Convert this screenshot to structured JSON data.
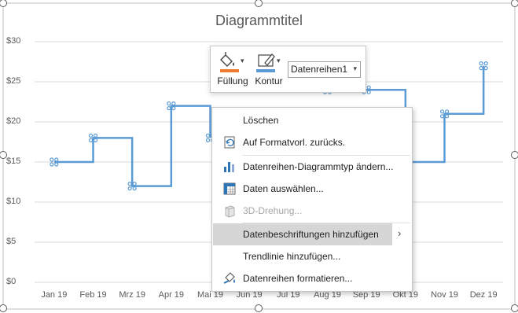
{
  "chart_data": {
    "type": "line",
    "title": "Diagrammtitel",
    "categories": [
      "Jan 19",
      "Feb 19",
      "Mrz 19",
      "Apr 19",
      "Mai 19",
      "Jun 19",
      "Jul 19",
      "Aug 19",
      "Sep 19",
      "Okt 19",
      "Nov 19",
      "Dez 19"
    ],
    "series": [
      {
        "values": [
          15,
          18,
          12,
          22,
          18,
          null,
          null,
          24,
          24,
          15,
          21,
          27
        ],
        "color": "#5b9bd5",
        "style": "step"
      }
    ],
    "yticks": [
      "$0",
      "$5",
      "$10",
      "$15",
      "$20",
      "$25",
      "$30"
    ],
    "ylim": [
      0,
      30
    ],
    "grid": true,
    "legend": "none"
  },
  "mini_toolbar": {
    "fill_label": "Füllung",
    "outline_label": "Kontur",
    "series_value": "Datenreihen1",
    "fill_color": "#ed7d31",
    "outline_color": "#5b9bd5"
  },
  "context_menu": {
    "items": [
      {
        "label": "Löschen",
        "icon": "none",
        "disabled": false
      },
      {
        "label": "Auf Formatvorl. zurücks.",
        "icon": "reset-style-icon",
        "disabled": false
      },
      {
        "label": "Datenreihen-Diagrammtyp ändern...",
        "icon": "chart-type-icon",
        "disabled": false
      },
      {
        "label": "Daten auswählen...",
        "icon": "select-data-icon",
        "disabled": false
      },
      {
        "label": "3D-Drehung...",
        "icon": "3d-rotation-icon",
        "disabled": true
      },
      {
        "label": "Datenbeschriftungen hinzufügen",
        "icon": "none",
        "disabled": false,
        "submenu": true
      },
      {
        "label": "Trendlinie hinzufügen...",
        "icon": "none",
        "disabled": false
      },
      {
        "label": "Datenreihen formatieren...",
        "icon": "format-series-icon",
        "disabled": false
      }
    ]
  }
}
